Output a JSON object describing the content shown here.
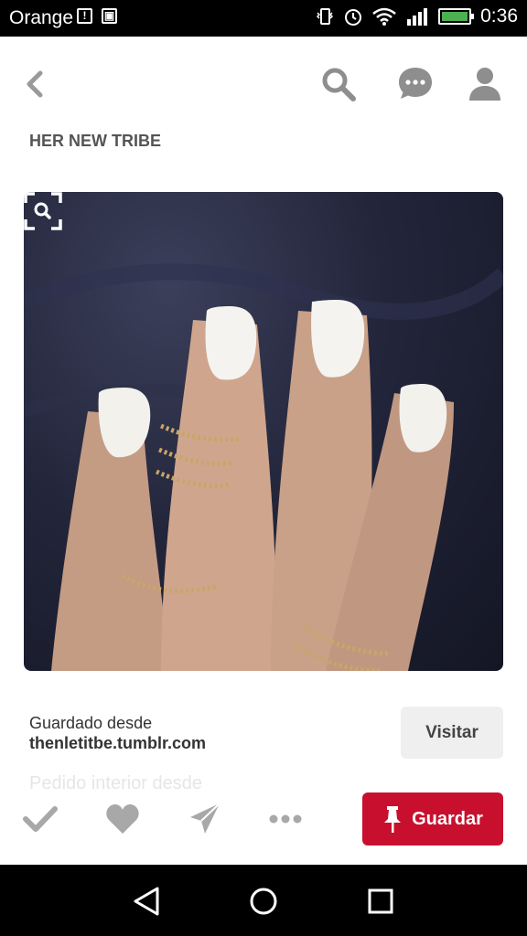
{
  "status_bar": {
    "carrier": "Orange",
    "time": "0:36"
  },
  "header": {
    "icons": [
      "back-chevron-icon",
      "search-icon",
      "chat-icon",
      "profile-icon"
    ]
  },
  "board": {
    "title": "HER NEW TRIBE"
  },
  "pin": {
    "image_description_icon": "visual-search-icon"
  },
  "source": {
    "saved_from_label": "Guardado desde",
    "domain": "thenletitbe.tumblr.com",
    "visit_label": "Visitar"
  },
  "faded_text": "Pedido interior desde",
  "actions": {
    "icons": [
      "check-icon",
      "heart-icon",
      "send-icon",
      "more-icon"
    ],
    "save_label": "Guardar",
    "save_color": "#c8102e"
  }
}
